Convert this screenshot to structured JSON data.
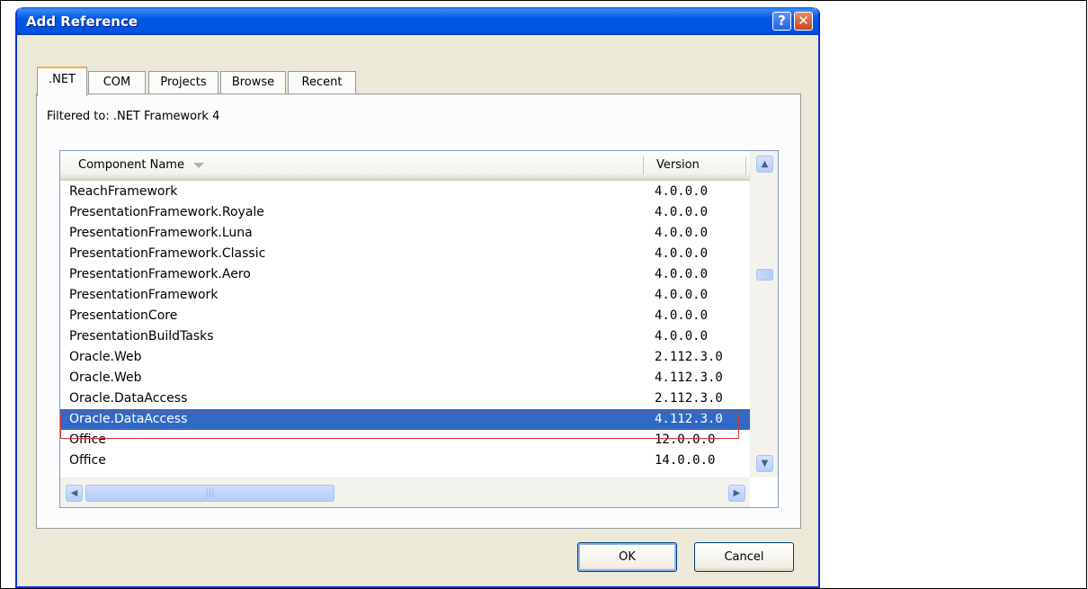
{
  "dialog": {
    "title": "Add Reference",
    "help_label": "?",
    "close_label": "✕"
  },
  "tabs": [
    {
      "label": ".NET",
      "active": true
    },
    {
      "label": "COM",
      "active": false
    },
    {
      "label": "Projects",
      "active": false
    },
    {
      "label": "Browse",
      "active": false
    },
    {
      "label": "Recent",
      "active": false
    }
  ],
  "filter_text": "Filtered to: .NET Framework 4",
  "list": {
    "columns": {
      "name": "Component Name",
      "version": "Version"
    },
    "rows": [
      {
        "name": "ReachFramework",
        "version": "4.0.0.0"
      },
      {
        "name": "PresentationFramework.Royale",
        "version": "4.0.0.0"
      },
      {
        "name": "PresentationFramework.Luna",
        "version": "4.0.0.0"
      },
      {
        "name": "PresentationFramework.Classic",
        "version": "4.0.0.0"
      },
      {
        "name": "PresentationFramework.Aero",
        "version": "4.0.0.0"
      },
      {
        "name": "PresentationFramework",
        "version": "4.0.0.0"
      },
      {
        "name": "PresentationCore",
        "version": "4.0.0.0"
      },
      {
        "name": "PresentationBuildTasks",
        "version": "4.0.0.0"
      },
      {
        "name": "Oracle.Web",
        "version": "2.112.3.0"
      },
      {
        "name": "Oracle.Web",
        "version": "4.112.3.0"
      },
      {
        "name": "Oracle.DataAccess",
        "version": "2.112.3.0"
      },
      {
        "name": "Oracle.DataAccess",
        "version": "4.112.3.0",
        "selected": true
      },
      {
        "name": "Office",
        "version": "12.0.0.0"
      },
      {
        "name": "Office",
        "version": "14.0.0.0"
      }
    ]
  },
  "buttons": {
    "ok": "OK",
    "cancel": "Cancel"
  },
  "colors": {
    "title_bar": "#0054E3",
    "selection": "#316AC5",
    "annotation_box": "#E03030",
    "dialog_face": "#ECE9D8"
  }
}
